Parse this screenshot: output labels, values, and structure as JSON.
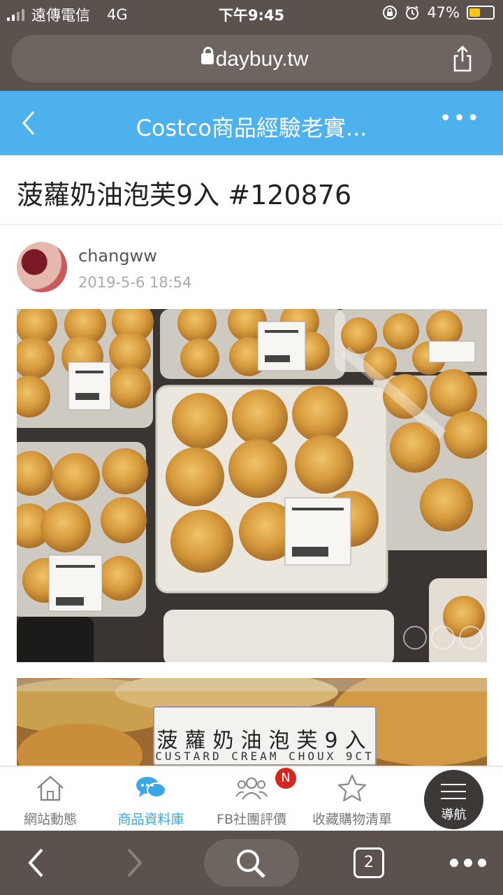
{
  "status_bar": {
    "carrier": "遠傳電信",
    "network": "4G",
    "time": "下午9:45",
    "battery_pct_text": "47%",
    "battery_level": 0.47
  },
  "url_bar": {
    "domain": "daybuy.tw"
  },
  "nav_bar": {
    "back_icon": "chevron-left-icon",
    "title": "Costco商品經驗老實...",
    "more_label": "•••"
  },
  "post": {
    "title": "菠蘿奶油泡芙9入 #120876",
    "author": "changww",
    "date": "2019-5-6 18:54"
  },
  "photo": {
    "label_zh": "菠蘿奶油泡芙9入",
    "label_en": "CUSTARD CREAM CHOUX 9CT"
  },
  "tab_bar": {
    "tabs": [
      {
        "label": "網站動態",
        "icon": "house-icon"
      },
      {
        "label": "商品資料庫",
        "icon": "chat-bubbles-icon"
      },
      {
        "label": "FB社團評價",
        "icon": "people-icon"
      },
      {
        "label": "收藏購物清單",
        "icon": "star-icon"
      }
    ],
    "active_index": 1,
    "badge": "N",
    "nav_button_label": "導航"
  },
  "browser_toolbar": {
    "tabs_count": "2"
  },
  "colors": {
    "accent": "#4db1ee",
    "chrome": "#5b514d",
    "badge": "#d9251d"
  }
}
